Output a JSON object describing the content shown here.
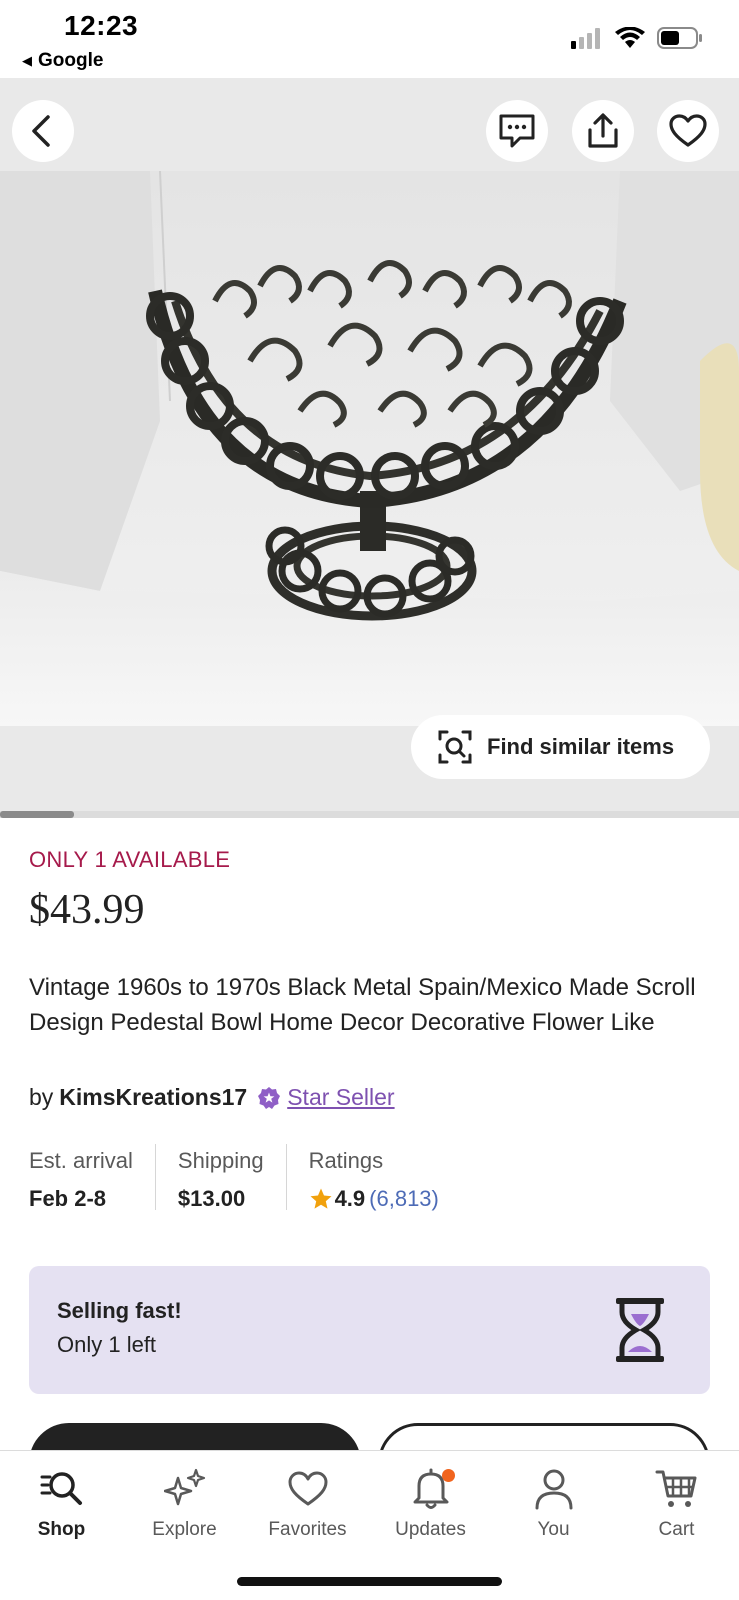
{
  "status_bar": {
    "time": "12:23",
    "back_app": "Google"
  },
  "listing": {
    "availability": "ONLY 1 AVAILABLE",
    "price": "$43.99",
    "title": "Vintage 1960s to 1970s Black Metal Spain/Mexico Made Scroll Design Pedestal Bowl Home Decor Decorative Flower Like",
    "by_label": "by",
    "seller": "KimsKreations17",
    "star_seller": "Star Seller"
  },
  "image_actions": {
    "find_similar": "Find similar items",
    "image_count_position": 0.1
  },
  "info": {
    "arrival_label": "Est. arrival",
    "arrival_value": "Feb 2-8",
    "shipping_label": "Shipping",
    "shipping_value": "$13.00",
    "ratings_label": "Ratings",
    "rating_value": "4.9",
    "rating_count": "(6,813)"
  },
  "selling_fast": {
    "title": "Selling fast!",
    "subtitle": "Only 1 left"
  },
  "tabs": [
    {
      "label": "Shop",
      "icon": "shop-search-icon",
      "active": true
    },
    {
      "label": "Explore",
      "icon": "sparkle-icon",
      "active": false
    },
    {
      "label": "Favorites",
      "icon": "heart-icon",
      "active": false
    },
    {
      "label": "Updates",
      "icon": "bell-icon",
      "active": false
    },
    {
      "label": "You",
      "icon": "person-icon",
      "active": false
    },
    {
      "label": "Cart",
      "icon": "cart-icon",
      "active": false
    }
  ],
  "colors": {
    "availability": "#a61a4b",
    "star_seller": "#7e51b0",
    "rating_count": "#4d6bb6",
    "selling_box": "#e5e1f2",
    "notification": "#f1641e",
    "star": "#f1a10d"
  },
  "icons": {
    "back": "chevron-left-icon",
    "message": "message-icon",
    "share": "share-icon",
    "favorite": "heart-icon",
    "find_similar": "visual-search-icon",
    "star_seller": "star-badge-icon",
    "rating": "star-icon",
    "selling_fast": "hourglass-icon"
  }
}
